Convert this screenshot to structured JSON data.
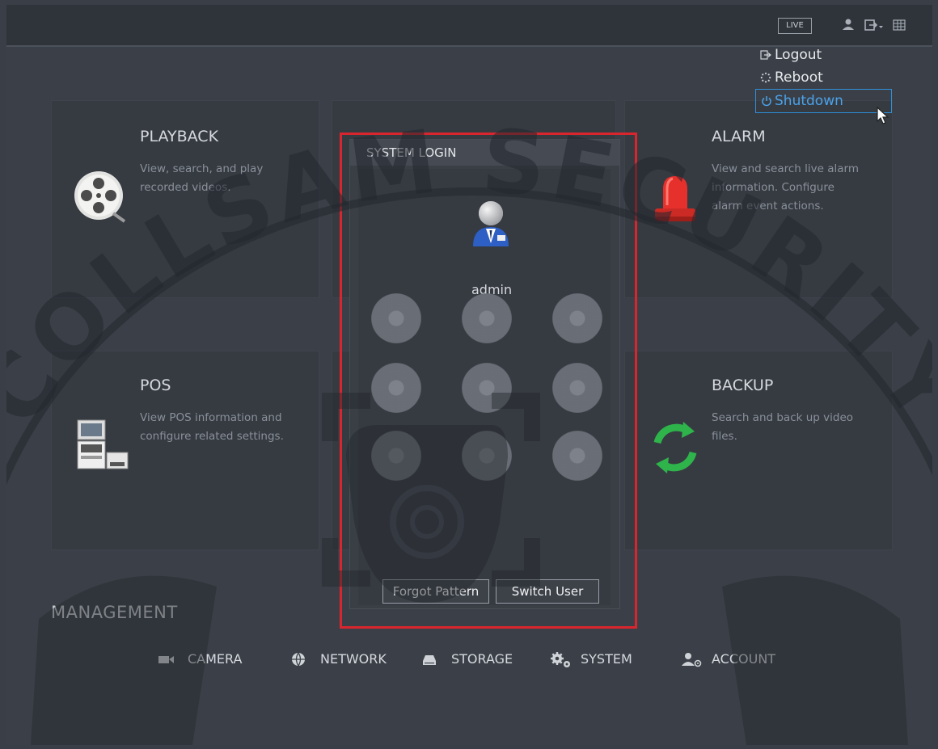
{
  "topbar": {
    "live_label": "LIVE"
  },
  "menu": {
    "items": [
      {
        "label": "Logout",
        "icon": "logout-icon"
      },
      {
        "label": "Reboot",
        "icon": "reboot-icon"
      },
      {
        "label": "Shutdown",
        "icon": "power-icon"
      }
    ],
    "selected": "Shutdown"
  },
  "features": {
    "playback": {
      "title": "PLAYBACK",
      "desc1": "View, search, and play",
      "desc2": "recorded videos."
    },
    "alarm": {
      "title": "ALARM",
      "desc1": "View and search live alarm",
      "desc2": "information. Configure",
      "desc3": "alarm event actions."
    },
    "pos": {
      "title": "POS",
      "desc1": "View POS information and",
      "desc2": "configure related settings."
    },
    "backup": {
      "title": "BACKUP",
      "desc1": "Search and back up video",
      "desc2": "files."
    }
  },
  "login": {
    "title": "SYSTEM LOGIN",
    "username": "admin",
    "forgot_label": "Forgot Pattern",
    "switch_label": "Switch User"
  },
  "management": {
    "title": "MANAGEMENT",
    "items": [
      {
        "label": "CAMERA",
        "icon": "camera-icon"
      },
      {
        "label": "NETWORK",
        "icon": "network-icon"
      },
      {
        "label": "STORAGE",
        "icon": "storage-icon"
      },
      {
        "label": "SYSTEM",
        "icon": "gears-icon"
      },
      {
        "label": "ACCOUNT",
        "icon": "account-icon"
      }
    ]
  },
  "watermark": {
    "text": "COLLSAM SECURITY"
  },
  "colors": {
    "accent": "#2e8fd8",
    "highlight_border": "#d9262e"
  }
}
